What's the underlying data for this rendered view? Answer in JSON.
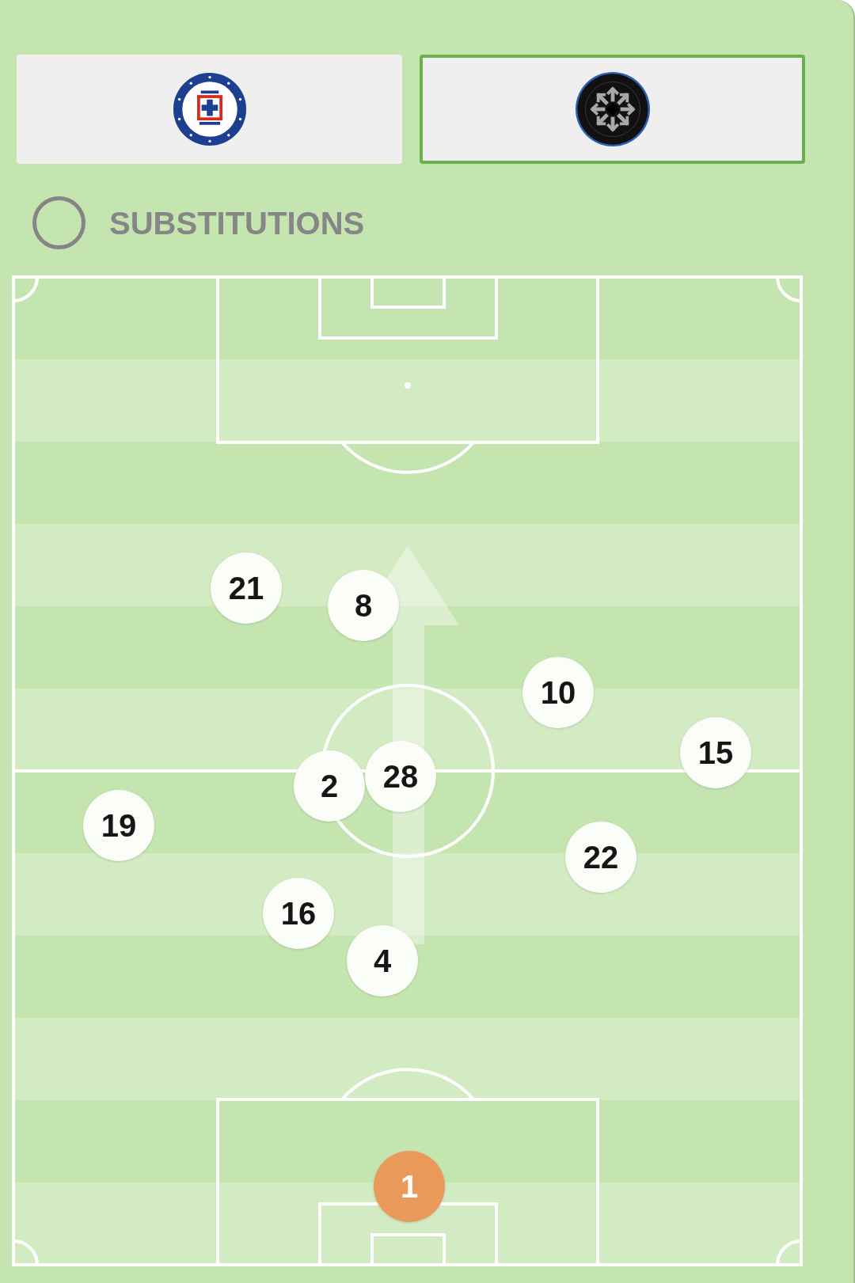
{
  "teams": [
    {
      "selected": false
    },
    {
      "selected": true
    }
  ],
  "substitutions": {
    "label": "SUBSTITUTIONS",
    "checked": false
  },
  "players": [
    {
      "number": "21",
      "kind": "outfield"
    },
    {
      "number": "8",
      "kind": "outfield"
    },
    {
      "number": "10",
      "kind": "outfield"
    },
    {
      "number": "15",
      "kind": "outfield"
    },
    {
      "number": "28",
      "kind": "outfield"
    },
    {
      "number": "2",
      "kind": "outfield"
    },
    {
      "number": "19",
      "kind": "outfield"
    },
    {
      "number": "22",
      "kind": "outfield"
    },
    {
      "number": "16",
      "kind": "outfield"
    },
    {
      "number": "4",
      "kind": "outfield"
    },
    {
      "number": "1",
      "kind": "goalkeeper"
    }
  ]
}
